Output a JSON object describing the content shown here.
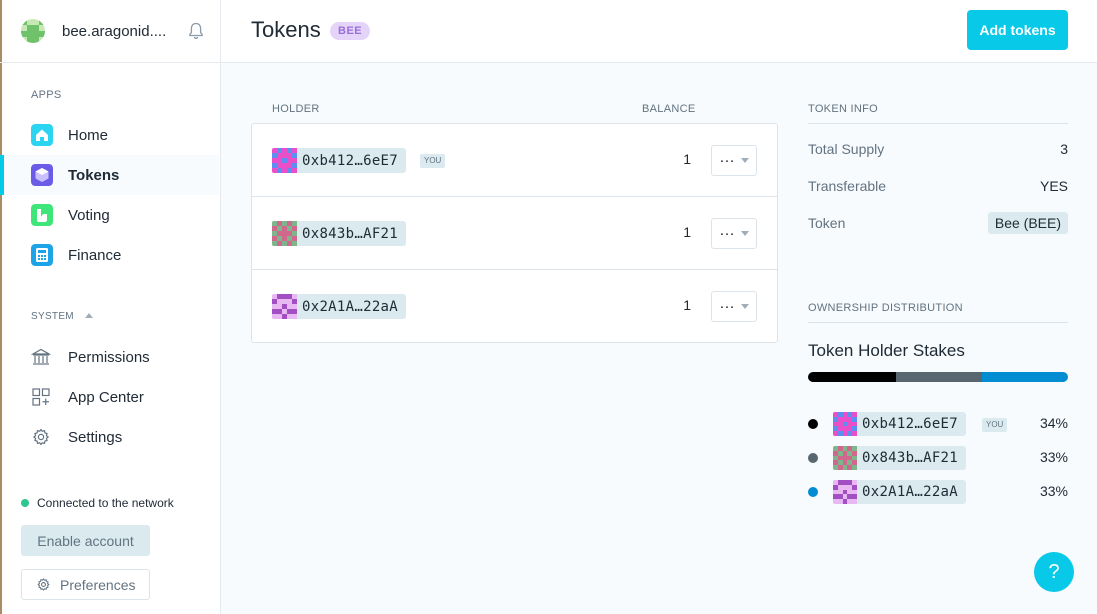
{
  "org": {
    "name": "bee.aragonid...."
  },
  "sidebar": {
    "apps_label": "APPS",
    "apps": [
      {
        "label": "Home",
        "icon": "home-icon",
        "color": "#2bd4f0"
      },
      {
        "label": "Tokens",
        "icon": "tokens-icon",
        "color": "#6b5ce7",
        "active": true
      },
      {
        "label": "Voting",
        "icon": "voting-icon",
        "color": "#3ee67a"
      },
      {
        "label": "Finance",
        "icon": "finance-icon",
        "color": "#1da3e8"
      }
    ],
    "system_label": "SYSTEM",
    "system": [
      {
        "label": "Permissions",
        "icon": "bank-icon"
      },
      {
        "label": "App Center",
        "icon": "app-center-icon"
      },
      {
        "label": "Settings",
        "icon": "gear-icon"
      }
    ],
    "network_status": "Connected to the network",
    "enable_account": "Enable account",
    "preferences": "Preferences"
  },
  "header": {
    "title": "Tokens",
    "badge": "BEE",
    "add_button": "Add tokens"
  },
  "holders": {
    "col_holder": "HOLDER",
    "col_balance": "BALANCE",
    "rows": [
      {
        "address": "0xb412…6eE7",
        "you": "YOU",
        "balance": "1"
      },
      {
        "address": "0x843b…AF21",
        "balance": "1"
      },
      {
        "address": "0x2A1A…22aA",
        "balance": "1"
      }
    ]
  },
  "token_info": {
    "heading": "TOKEN INFO",
    "total_supply_label": "Total Supply",
    "total_supply": "3",
    "transferable_label": "Transferable",
    "transferable": "YES",
    "token_label": "Token",
    "token": "Bee (BEE)"
  },
  "distribution": {
    "heading": "OWNERSHIP DISTRIBUTION",
    "title": "Token Holder Stakes",
    "stakes": [
      {
        "address": "0xb412…6eE7",
        "you": "YOU",
        "pct": "34%",
        "share": 0.34,
        "color": "#000000"
      },
      {
        "address": "0x843b…AF21",
        "pct": "33%",
        "share": 0.33,
        "color": "#57666f"
      },
      {
        "address": "0x2A1A…22aA",
        "pct": "33%",
        "share": 0.33,
        "color": "#028cd1"
      }
    ]
  },
  "help": "?"
}
